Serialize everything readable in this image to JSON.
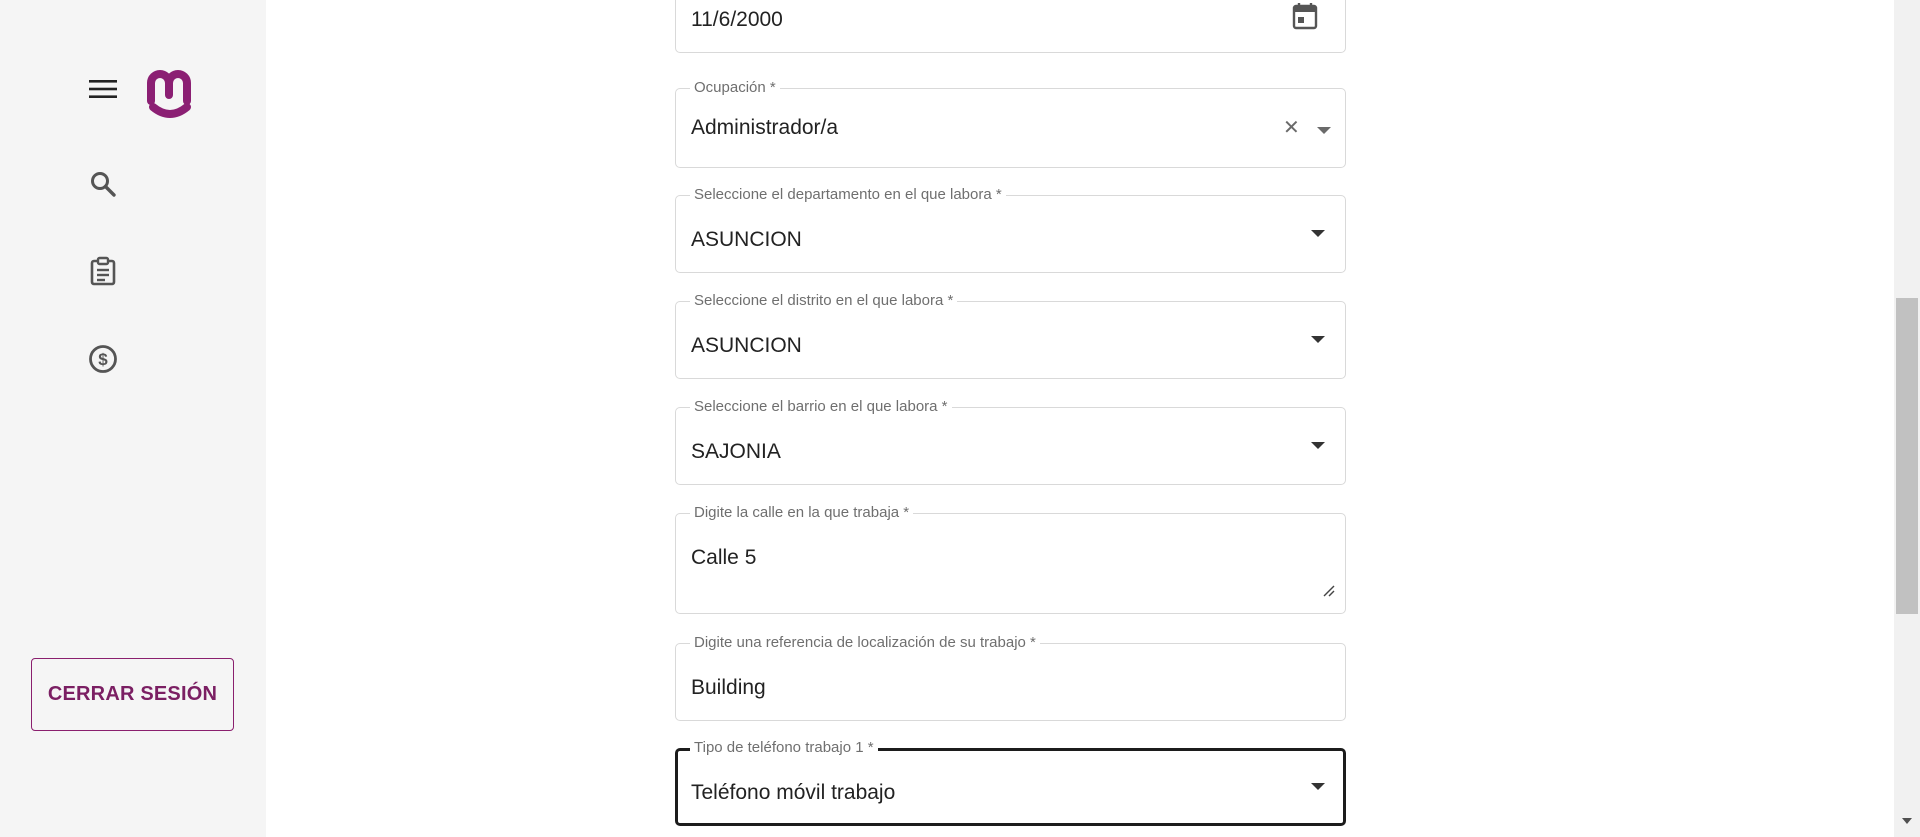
{
  "sidebar": {
    "menu_icon": "hamburger-menu-icon",
    "logo_icon": "brand-logo-icon",
    "nav": [
      {
        "icon": "search-icon"
      },
      {
        "icon": "clipboard-icon"
      },
      {
        "icon": "dollar-coin-icon"
      }
    ],
    "logout_label": "CERRAR SESIÓN",
    "brand_color": "#8b1f73"
  },
  "form": {
    "birth_date": {
      "value": "11/6/2000",
      "icon": "calendar-icon"
    },
    "occupation": {
      "label": "Ocupación *",
      "value": "Administrador/a",
      "clear_icon": "close-icon",
      "dropdown_icon": "caret-down-icon"
    },
    "department": {
      "label": "Seleccione el departamento en el que labora *",
      "value": "ASUNCION",
      "dropdown_icon": "caret-down-icon"
    },
    "district": {
      "label": "Seleccione el distrito en el que labora *",
      "value": "ASUNCION",
      "dropdown_icon": "caret-down-icon"
    },
    "neighborhood": {
      "label": "Seleccione el barrio en el que labora *",
      "value": "SAJONIA",
      "dropdown_icon": "caret-down-icon"
    },
    "street": {
      "label": "Digite la calle en la que trabaja *",
      "value": "Calle 5",
      "resize_icon": "resize-handle-icon"
    },
    "reference": {
      "label": "Digite una referencia de localización de su trabajo *",
      "value": "Building"
    },
    "phone_type": {
      "label": "Tipo de teléfono trabajo 1 *",
      "value": "Teléfono móvil trabajo",
      "dropdown_icon": "caret-down-icon"
    }
  }
}
